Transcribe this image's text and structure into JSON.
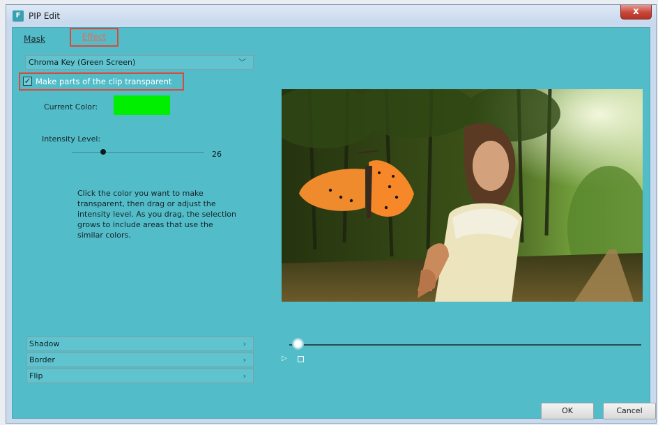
{
  "window": {
    "title": "PIP Edit",
    "icon_letter": "F",
    "close_label": "x"
  },
  "tabs": [
    {
      "label": "Mask",
      "active": false
    },
    {
      "label": "Effect",
      "active": true
    }
  ],
  "effect_select": {
    "value": "Chroma Key (Green Screen)"
  },
  "transparent_checkbox": {
    "label": "Make parts of the clip transparent",
    "checked": true
  },
  "current_color": {
    "label": "Current Color:",
    "color": "#00ee00"
  },
  "intensity": {
    "label": "Intensity Level:",
    "value": "26",
    "fraction": 0.26
  },
  "help_text": "Click the color you want to make transparent, then drag or adjust the intensity level. As you drag, the selection grows to include areas that use the similar colors.",
  "sections": [
    {
      "label": "Shadow"
    },
    {
      "label": "Border"
    },
    {
      "label": "Flip"
    }
  ],
  "preview": {
    "playhead_fraction": 0.0
  },
  "buttons": {
    "ok": "OK",
    "cancel": "Cancel"
  },
  "colors": {
    "panel": "#52bcc8",
    "highlight": "#d94a3c",
    "key_color": "#00ee00"
  },
  "icons": {
    "chevron": "chevron-right-icon",
    "dropdown": "chevron-down-icon",
    "play": "play-icon",
    "stop": "stop-icon"
  }
}
